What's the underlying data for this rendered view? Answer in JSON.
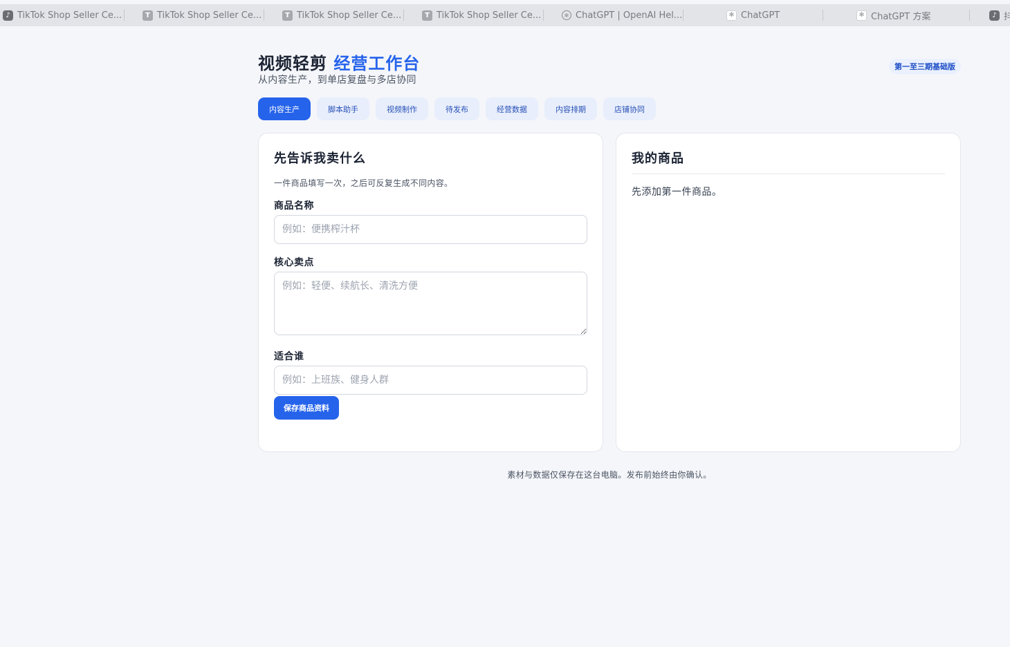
{
  "browser": {
    "tabs": [
      {
        "title": "TikTok Shop Seller Ce...",
        "icon": "tiktok-icon"
      },
      {
        "title": "TikTok Shop Seller Ce...",
        "icon": "t-letter-icon"
      },
      {
        "title": "TikTok Shop Seller Ce...",
        "icon": "t-letter-icon"
      },
      {
        "title": "TikTok Shop Seller Ce...",
        "icon": "t-letter-icon"
      },
      {
        "title": "ChatGPT | OpenAI Hel...",
        "icon": "openai-icon"
      },
      {
        "title": "ChatGPT",
        "icon": "openai-icon"
      },
      {
        "title": "ChatGPT 方案",
        "icon": "openai-icon"
      },
      {
        "title": "抖音",
        "icon": "tiktok-icon"
      }
    ]
  },
  "header": {
    "title_main": "视频轻剪",
    "title_accent": "经营工作台",
    "subtitle": "从内容生产，到单店复盘与多店协同",
    "version_badge": "第一至三期基础版"
  },
  "nav": {
    "tabs": [
      {
        "label": "内容生产",
        "active": true
      },
      {
        "label": "脚本助手",
        "active": false
      },
      {
        "label": "视频制作",
        "active": false
      },
      {
        "label": "待发布",
        "active": false
      },
      {
        "label": "经营数据",
        "active": false
      },
      {
        "label": "内容排期",
        "active": false
      },
      {
        "label": "店铺协同",
        "active": false
      }
    ]
  },
  "product_form": {
    "title": "先告诉我卖什么",
    "description": "一件商品填写一次，之后可反复生成不同内容。",
    "name_label": "商品名称",
    "name_placeholder": "例如：便携榨汁杯",
    "name_value": "",
    "selling_points_label": "核心卖点",
    "selling_points_placeholder": "例如：轻便、续航长、清洗方便",
    "selling_points_value": "",
    "audience_label": "适合谁",
    "audience_placeholder": "例如：上班族、健身人群",
    "audience_value": "",
    "save_button": "保存商品资料"
  },
  "my_products": {
    "title": "我的商品",
    "empty_text": "先添加第一件商品。"
  },
  "footer": {
    "note": "素材与数据仅保存在这台电脑。发布前始终由你确认。"
  },
  "colors": {
    "accent": "#2563eb",
    "background": "#f5f6fa",
    "badge_bg": "#eaf0fe",
    "nav_tab_bg": "#e8eefb"
  }
}
